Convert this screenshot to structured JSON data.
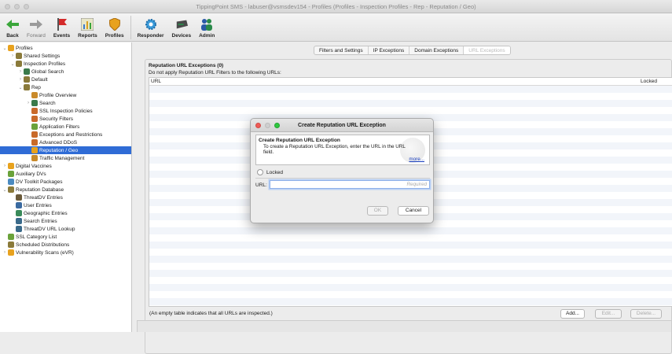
{
  "window": {
    "title": "TippingPoint SMS - labuser@vsmsdev154 - Profiles (Profiles - Inspection Profiles - Rep - Reputation / Geo)"
  },
  "toolbar": [
    {
      "label": "Back",
      "icon": "back-arrow-icon",
      "enabled": true
    },
    {
      "label": "Forward",
      "icon": "forward-arrow-icon",
      "enabled": false
    },
    {
      "label": "Events",
      "icon": "events-flag-icon",
      "enabled": true
    },
    {
      "label": "Reports",
      "icon": "reports-chart-icon",
      "enabled": true
    },
    {
      "label": "Profiles",
      "icon": "profiles-shield-icon",
      "enabled": true
    },
    {
      "label": "Responder",
      "icon": "responder-gear-icon",
      "enabled": true
    },
    {
      "label": "Devices",
      "icon": "devices-icon",
      "enabled": true
    },
    {
      "label": "Admin",
      "icon": "admin-users-icon",
      "enabled": true
    }
  ],
  "tree": [
    {
      "label": "Profiles",
      "depth": 0,
      "arrow": "v",
      "color": "#e8a21e"
    },
    {
      "label": "Shared Settings",
      "depth": 1,
      "arrow": ">",
      "color": "#8a7a3a"
    },
    {
      "label": "Inspection Profiles",
      "depth": 1,
      "arrow": "v",
      "color": "#8a7a3a"
    },
    {
      "label": "Global Search",
      "depth": 2,
      "arrow": ">",
      "color": "#3a7a4a"
    },
    {
      "label": "Default",
      "depth": 2,
      "arrow": ">",
      "color": "#8a7a3a"
    },
    {
      "label": "Rep",
      "depth": 2,
      "arrow": "v",
      "color": "#8a7a3a"
    },
    {
      "label": "Profile Overview",
      "depth": 3,
      "arrow": "",
      "color": "#c98a2a"
    },
    {
      "label": "Search",
      "depth": 3,
      "arrow": ">",
      "color": "#3a7a4a"
    },
    {
      "label": "SSL Inspection Policies",
      "depth": 3,
      "arrow": "",
      "color": "#c96a2a"
    },
    {
      "label": "Security Filters",
      "depth": 3,
      "arrow": "",
      "color": "#c96a2a"
    },
    {
      "label": "Application Filters",
      "depth": 3,
      "arrow": "",
      "color": "#6aa23a"
    },
    {
      "label": "Exceptions and Restrictions",
      "depth": 3,
      "arrow": "",
      "color": "#c96a2a"
    },
    {
      "label": "Advanced DDoS",
      "depth": 3,
      "arrow": "",
      "color": "#c96a2a"
    },
    {
      "label": "Reputation / Geo",
      "depth": 3,
      "arrow": "",
      "color": "#e8a21e",
      "selected": true
    },
    {
      "label": "Traffic Management",
      "depth": 3,
      "arrow": "",
      "color": "#c98a2a"
    },
    {
      "label": "Digital Vaccines",
      "depth": 0,
      "arrow": ">",
      "color": "#e8a21e"
    },
    {
      "label": "Auxiliary DVs",
      "depth": 0,
      "arrow": "",
      "color": "#6aa23a"
    },
    {
      "label": "DV Toolkit Packages",
      "depth": 0,
      "arrow": "",
      "color": "#4a8ac0"
    },
    {
      "label": "Reputation Database",
      "depth": 0,
      "arrow": "v",
      "color": "#8a7a3a"
    },
    {
      "label": "ThreatDV Entries",
      "depth": 1,
      "arrow": "",
      "color": "#6a5a3a"
    },
    {
      "label": "User Entries",
      "depth": 1,
      "arrow": "",
      "color": "#3a6aa0"
    },
    {
      "label": "Geographic Entries",
      "depth": 1,
      "arrow": "",
      "color": "#3a8a5a"
    },
    {
      "label": "Search Entries",
      "depth": 1,
      "arrow": "",
      "color": "#3a6a8a"
    },
    {
      "label": "ThreatDV URL Lookup",
      "depth": 1,
      "arrow": "",
      "color": "#3a6a8a"
    },
    {
      "label": "SSL Category List",
      "depth": 0,
      "arrow": "",
      "color": "#6aa23a"
    },
    {
      "label": "Scheduled Distributions",
      "depth": 0,
      "arrow": "",
      "color": "#8a7a3a"
    },
    {
      "label": "Vulnerability Scans (eVR)",
      "depth": 0,
      "arrow": ">",
      "color": "#e8a21e"
    }
  ],
  "tabs": [
    {
      "label": "Filters and Settings",
      "active": false
    },
    {
      "label": "IP Exceptions",
      "active": false
    },
    {
      "label": "Domain Exceptions",
      "active": false
    },
    {
      "label": "URL Exceptions",
      "active": true
    }
  ],
  "panel": {
    "title": "Reputation URL Exceptions (0)",
    "description": "Do not apply Reputation URL Filters to the following URLs:",
    "columns": [
      "URL",
      "Locked"
    ],
    "footnote": "(An empty table indicates that all URLs are inspected.)",
    "add_label": "Add...",
    "edit_label": "Edit...",
    "delete_label": "Delete..."
  },
  "dialog": {
    "title": "Create Reputation URL Exception",
    "banner_heading": "Create Reputation URL Exception",
    "banner_text": "To create a Reputation URL Exception, enter the URL in the URL field.",
    "more_link": "more...",
    "locked_label": "Locked",
    "url_label": "URL:",
    "url_value": "",
    "url_placeholder": "Required",
    "ok_label": "OK",
    "cancel_label": "Cancel"
  }
}
